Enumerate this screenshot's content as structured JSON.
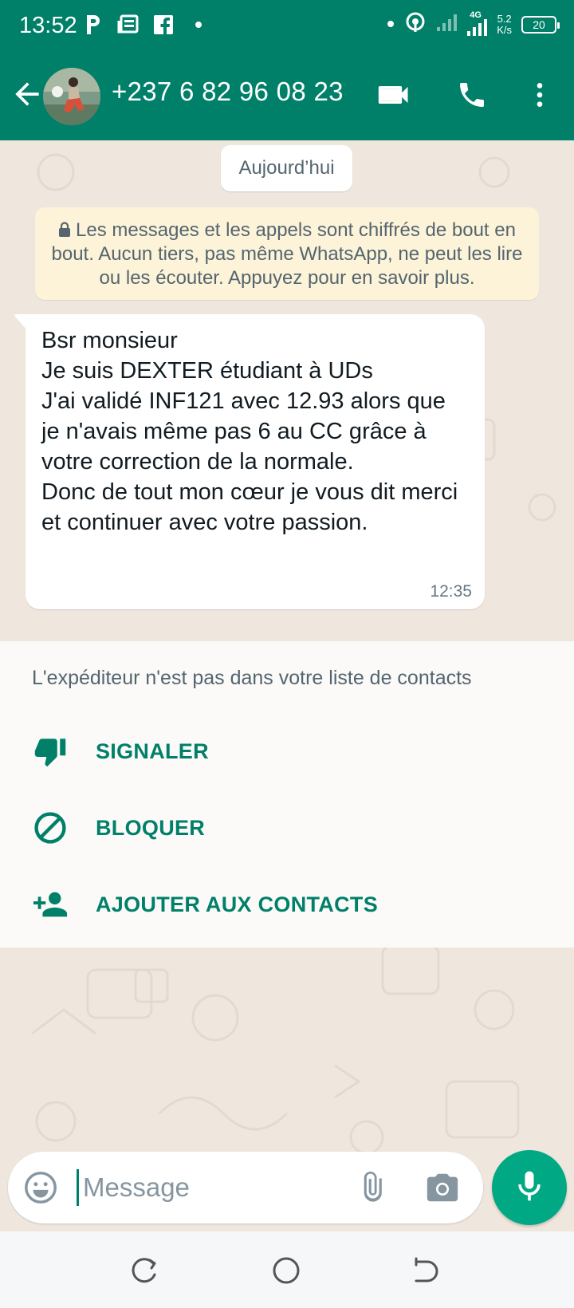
{
  "status_bar": {
    "time": "13:52",
    "icons": [
      "parking-icon",
      "news-icon",
      "facebook-icon",
      "dot-icon"
    ],
    "right_icons": [
      "dot-icon",
      "hotspot-icon",
      "signal-icon",
      "4g-signal-icon"
    ],
    "network_type": "4G",
    "speed_value": "5.2",
    "speed_unit": "K/s",
    "battery": "20"
  },
  "header": {
    "contact_name": "+237 6 82 96 08 23",
    "icons": [
      "back-arrow-icon",
      "video-call-icon",
      "phone-call-icon",
      "more-vert-icon"
    ],
    "colors": {
      "bar": "#008069",
      "accent": "#00a884"
    }
  },
  "chat": {
    "date_chip": "Aujourd’hui",
    "encryption_notice": "Les messages et les appels sont chiffrés de bout en bout. Aucun tiers, pas même WhatsApp, ne peut les lire ou les écouter. Appuyez pour en savoir plus.",
    "messages": [
      {
        "text": "Bsr monsieur\nJe suis DEXTER étudiant à UDs\nJ'ai validé INF121 avec 12.93 alors que je n'avais même pas 6 au CC grâce à votre correction de la normale.\nDonc de tout mon cœur je vous dit merci et continuer avec votre passion.",
        "time": "12:35",
        "direction": "incoming"
      }
    ]
  },
  "unknown_sender": {
    "note": "L'expéditeur n'est pas dans votre liste de contacts",
    "actions": [
      {
        "label": "SIGNALER",
        "icon": "thumb-down-icon"
      },
      {
        "label": "BLOQUER",
        "icon": "block-icon"
      },
      {
        "label": "AJOUTER AUX CONTACTS",
        "icon": "add-person-icon"
      }
    ]
  },
  "composer": {
    "placeholder": "Message",
    "value": "",
    "icons": [
      "emoji-icon",
      "attach-icon",
      "camera-icon",
      "mic-icon"
    ]
  },
  "navigation": {
    "icons": [
      "recents-icon",
      "home-icon",
      "back-nav-icon"
    ]
  }
}
